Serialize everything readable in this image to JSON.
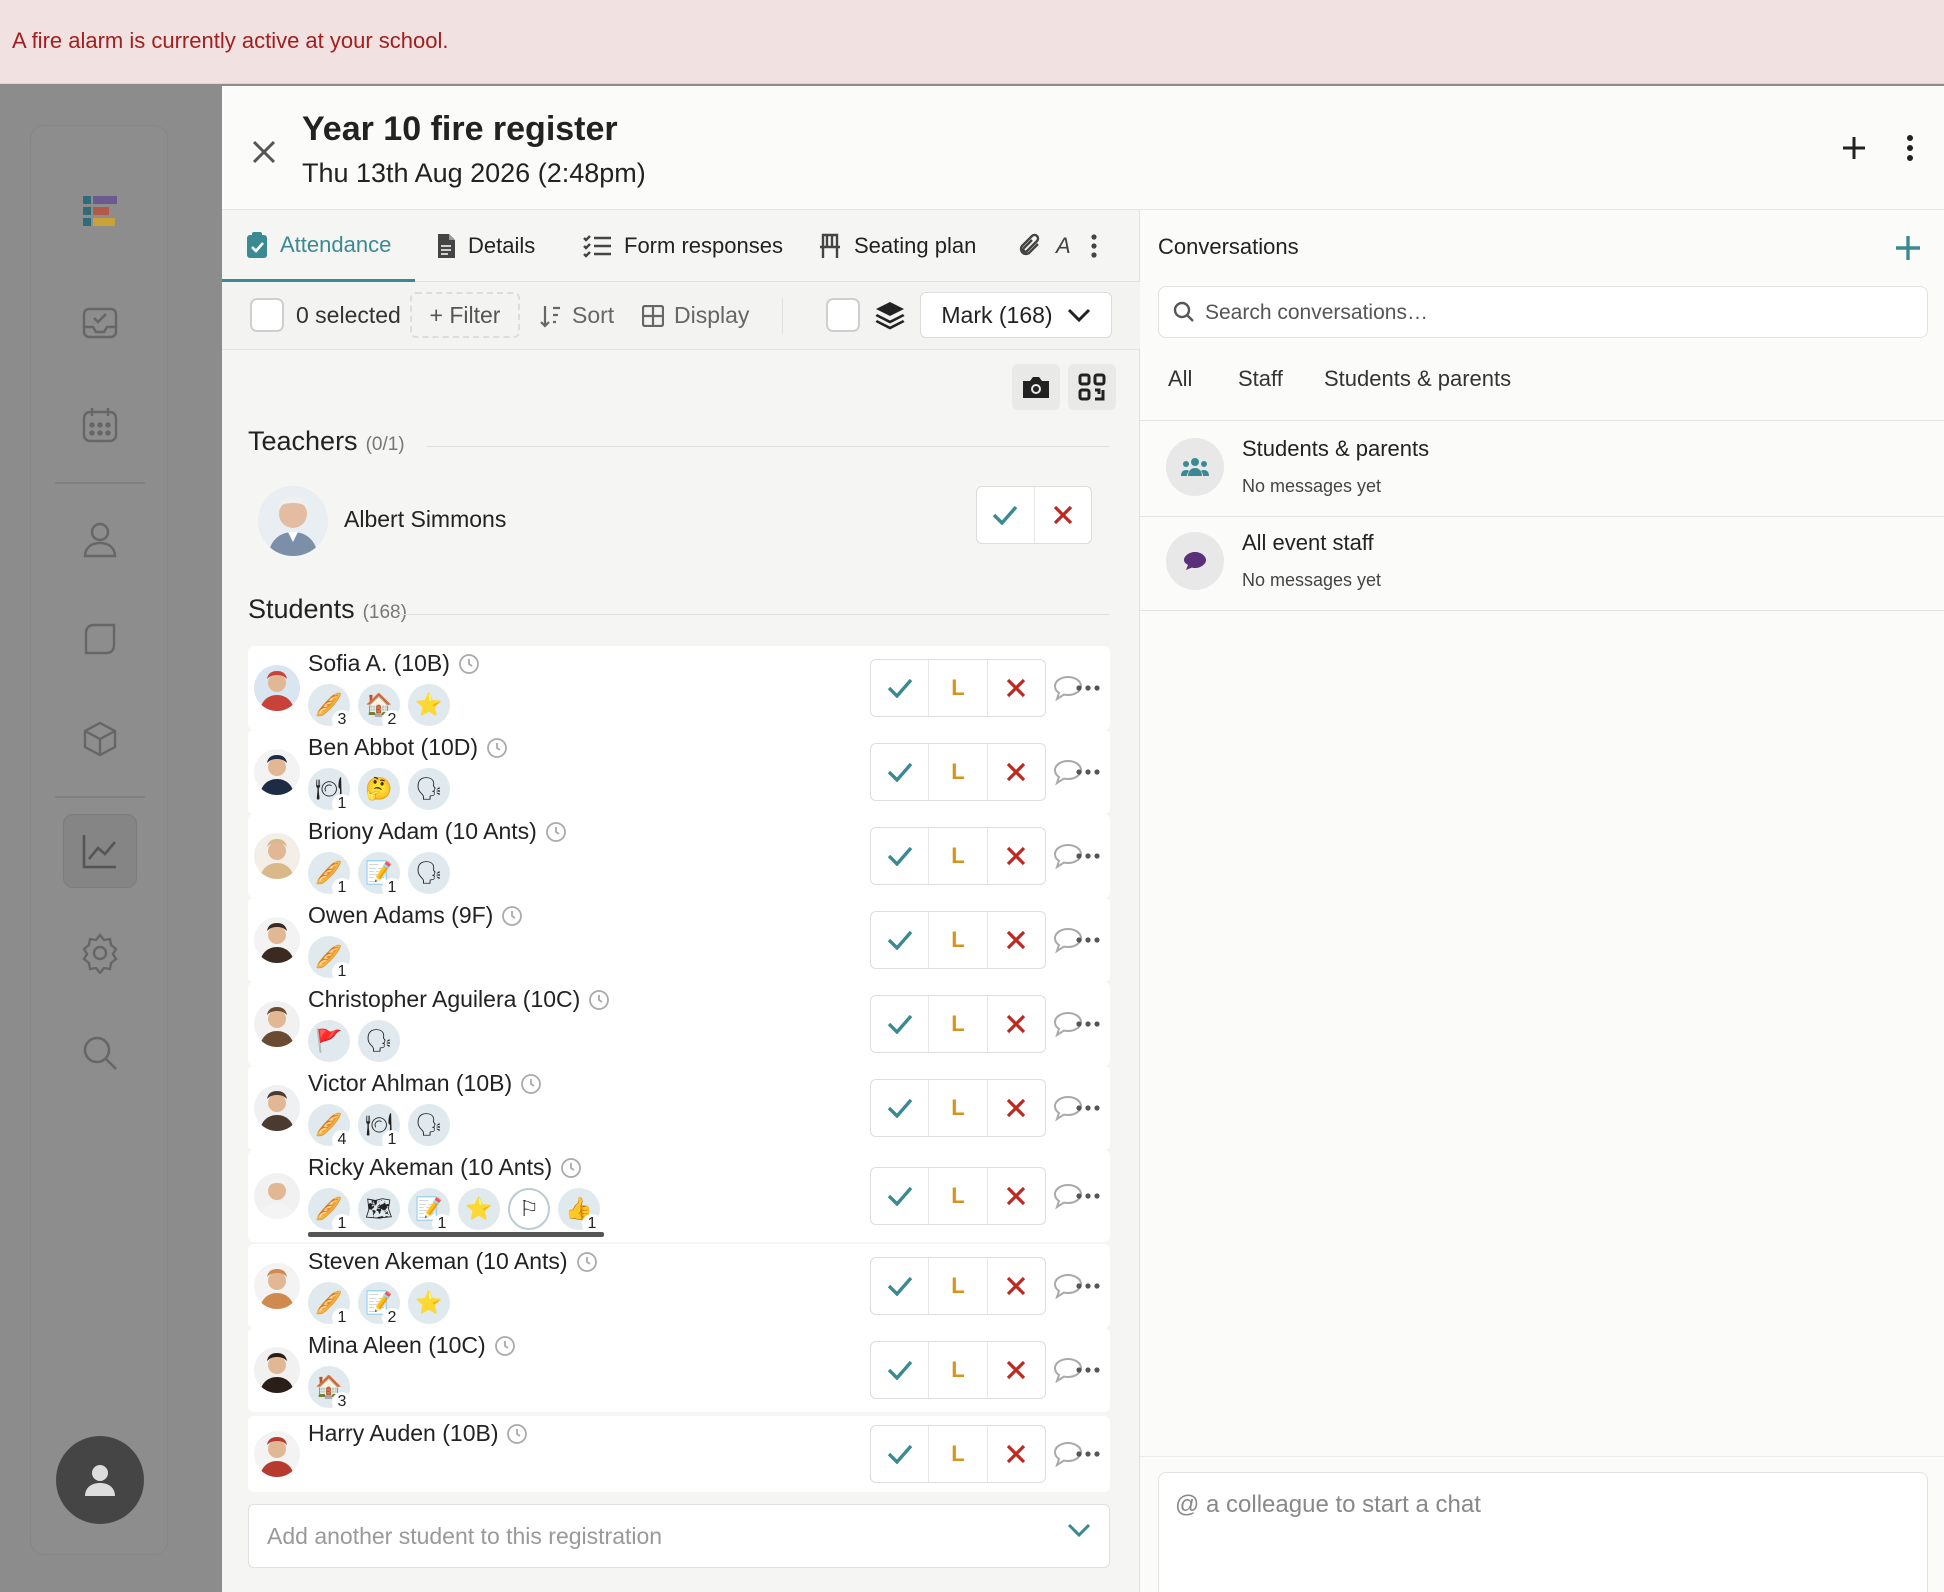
{
  "alert": {
    "text": "A fire alarm is currently active at your school."
  },
  "header": {
    "title": "Year 10 fire register",
    "subtitle": "Thu 13th Aug 2026 (2:48pm)"
  },
  "tabs": [
    {
      "label": "Attendance",
      "icon": "clipboard-check-icon"
    },
    {
      "label": "Details",
      "icon": "document-icon"
    },
    {
      "label": "Form responses",
      "icon": "checklist-icon"
    },
    {
      "label": "Seating plan",
      "icon": "chair-icon"
    },
    {
      "label": "A",
      "icon": "paperclip-icon"
    }
  ],
  "toolbar": {
    "selected": "0 selected",
    "filter": "+ Filter",
    "sort": "Sort",
    "display": "Display",
    "mark": "Mark (168)"
  },
  "teachers": {
    "label": "Teachers",
    "count": "(0/1)",
    "items": [
      {
        "name": "Albert Simmons"
      }
    ]
  },
  "students": {
    "label": "Students",
    "count": "(168)",
    "late_label": "L",
    "items": [
      {
        "name": "Sofia A. (10B)",
        "badges": [
          {
            "icon": "🥖",
            "count": "3"
          },
          {
            "icon": "🏠",
            "count": "2"
          },
          {
            "icon": "⭐",
            "count": ""
          }
        ]
      },
      {
        "name": "Ben Abbot (10D)",
        "badges": [
          {
            "icon": "🍽",
            "count": "1"
          },
          {
            "icon": "🤔",
            "count": ""
          },
          {
            "icon": "🗣",
            "count": ""
          }
        ]
      },
      {
        "name": "Briony Adam (10 Ants)",
        "badges": [
          {
            "icon": "🥖",
            "count": "1"
          },
          {
            "icon": "📝",
            "count": "1"
          },
          {
            "icon": "🗣",
            "count": ""
          }
        ]
      },
      {
        "name": "Owen Adams (9F)",
        "badges": [
          {
            "icon": "🥖",
            "count": "1"
          }
        ]
      },
      {
        "name": "Christopher Aguilera (10C)",
        "badges": [
          {
            "icon": "🚩",
            "count": ""
          },
          {
            "icon": "🗣",
            "count": ""
          }
        ]
      },
      {
        "name": "Victor Ahlman (10B)",
        "badges": [
          {
            "icon": "🥖",
            "count": "4"
          },
          {
            "icon": "🍽",
            "count": "1"
          },
          {
            "icon": "🗣",
            "count": ""
          }
        ]
      },
      {
        "name": "Ricky Akeman (10 Ants)",
        "badges": [
          {
            "icon": "🥖",
            "count": "1"
          },
          {
            "icon": "🗺",
            "count": ""
          },
          {
            "icon": "📝",
            "count": "1"
          },
          {
            "icon": "⭐",
            "count": ""
          },
          {
            "icon": "⚐",
            "count": ""
          },
          {
            "icon": "👍",
            "count": "1"
          }
        ]
      },
      {
        "name": "Steven Akeman (10 Ants)",
        "badges": [
          {
            "icon": "🥖",
            "count": "1"
          },
          {
            "icon": "📝",
            "count": "2"
          },
          {
            "icon": "⭐",
            "count": ""
          }
        ]
      },
      {
        "name": "Mina Aleen (10C)",
        "badges": [
          {
            "icon": "🏠",
            "count": "3"
          }
        ]
      },
      {
        "name": "Harry Auden (10B)",
        "badges": []
      }
    ]
  },
  "add_student": {
    "placeholder": "Add another student to this registration"
  },
  "conversations": {
    "title": "Conversations",
    "search_placeholder": "Search conversations…",
    "tabs": [
      "All",
      "Staff",
      "Students & parents"
    ],
    "items": [
      {
        "name": "Students & parents",
        "message": "No messages yet",
        "icon": "people-icon",
        "icon_color": "#3b8a93"
      },
      {
        "name": "All event staff",
        "message": "No messages yet",
        "icon": "chat-bubble-icon",
        "icon_color": "#5b2f7a"
      }
    ],
    "compose_placeholder": "@ a colleague to start a chat"
  },
  "colors": {
    "accent": "#3b8a93",
    "present": "#3b8a93",
    "late": "#d7931b",
    "absent": "#c0271e",
    "alert_bg": "#f1e1e1",
    "alert_text": "#a21f1f"
  }
}
